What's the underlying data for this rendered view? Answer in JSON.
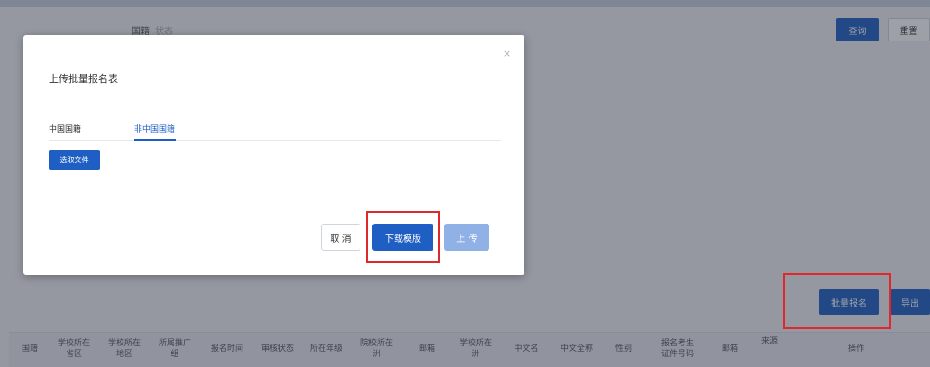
{
  "filters": {
    "label_a": "国籍",
    "label_b": "状态"
  },
  "toolbar": {
    "query_label": "查询",
    "reset_label": "重置",
    "batch_register_label": "批量报名",
    "export_label": "导出"
  },
  "table": {
    "columns": [
      "国籍",
      "学校所在\n省区",
      "学校所在\n地区",
      "所属推广\n组",
      "报名时间",
      "审核状态",
      "所在年级",
      "院校所在\n洲",
      "邮箱",
      "学校所在\n洲",
      "中文名",
      "中文全称",
      "性别",
      "报名考生\n证件号码",
      "邮箱",
      "来源",
      "操作"
    ]
  },
  "modal": {
    "title": "上传批量报名表",
    "close_glyph": "×",
    "tabs": [
      {
        "label": "中国国籍",
        "active": false
      },
      {
        "label": "非中国国籍",
        "active": true
      }
    ],
    "choose_file_label": "选取文件",
    "cancel_label": "取 消",
    "download_template_label": "下载模版",
    "upload_label": "上 传"
  },
  "colors": {
    "primary": "#1f5fc4",
    "highlight": "#e0272a",
    "upload_disabled": "#8fb1e6"
  }
}
